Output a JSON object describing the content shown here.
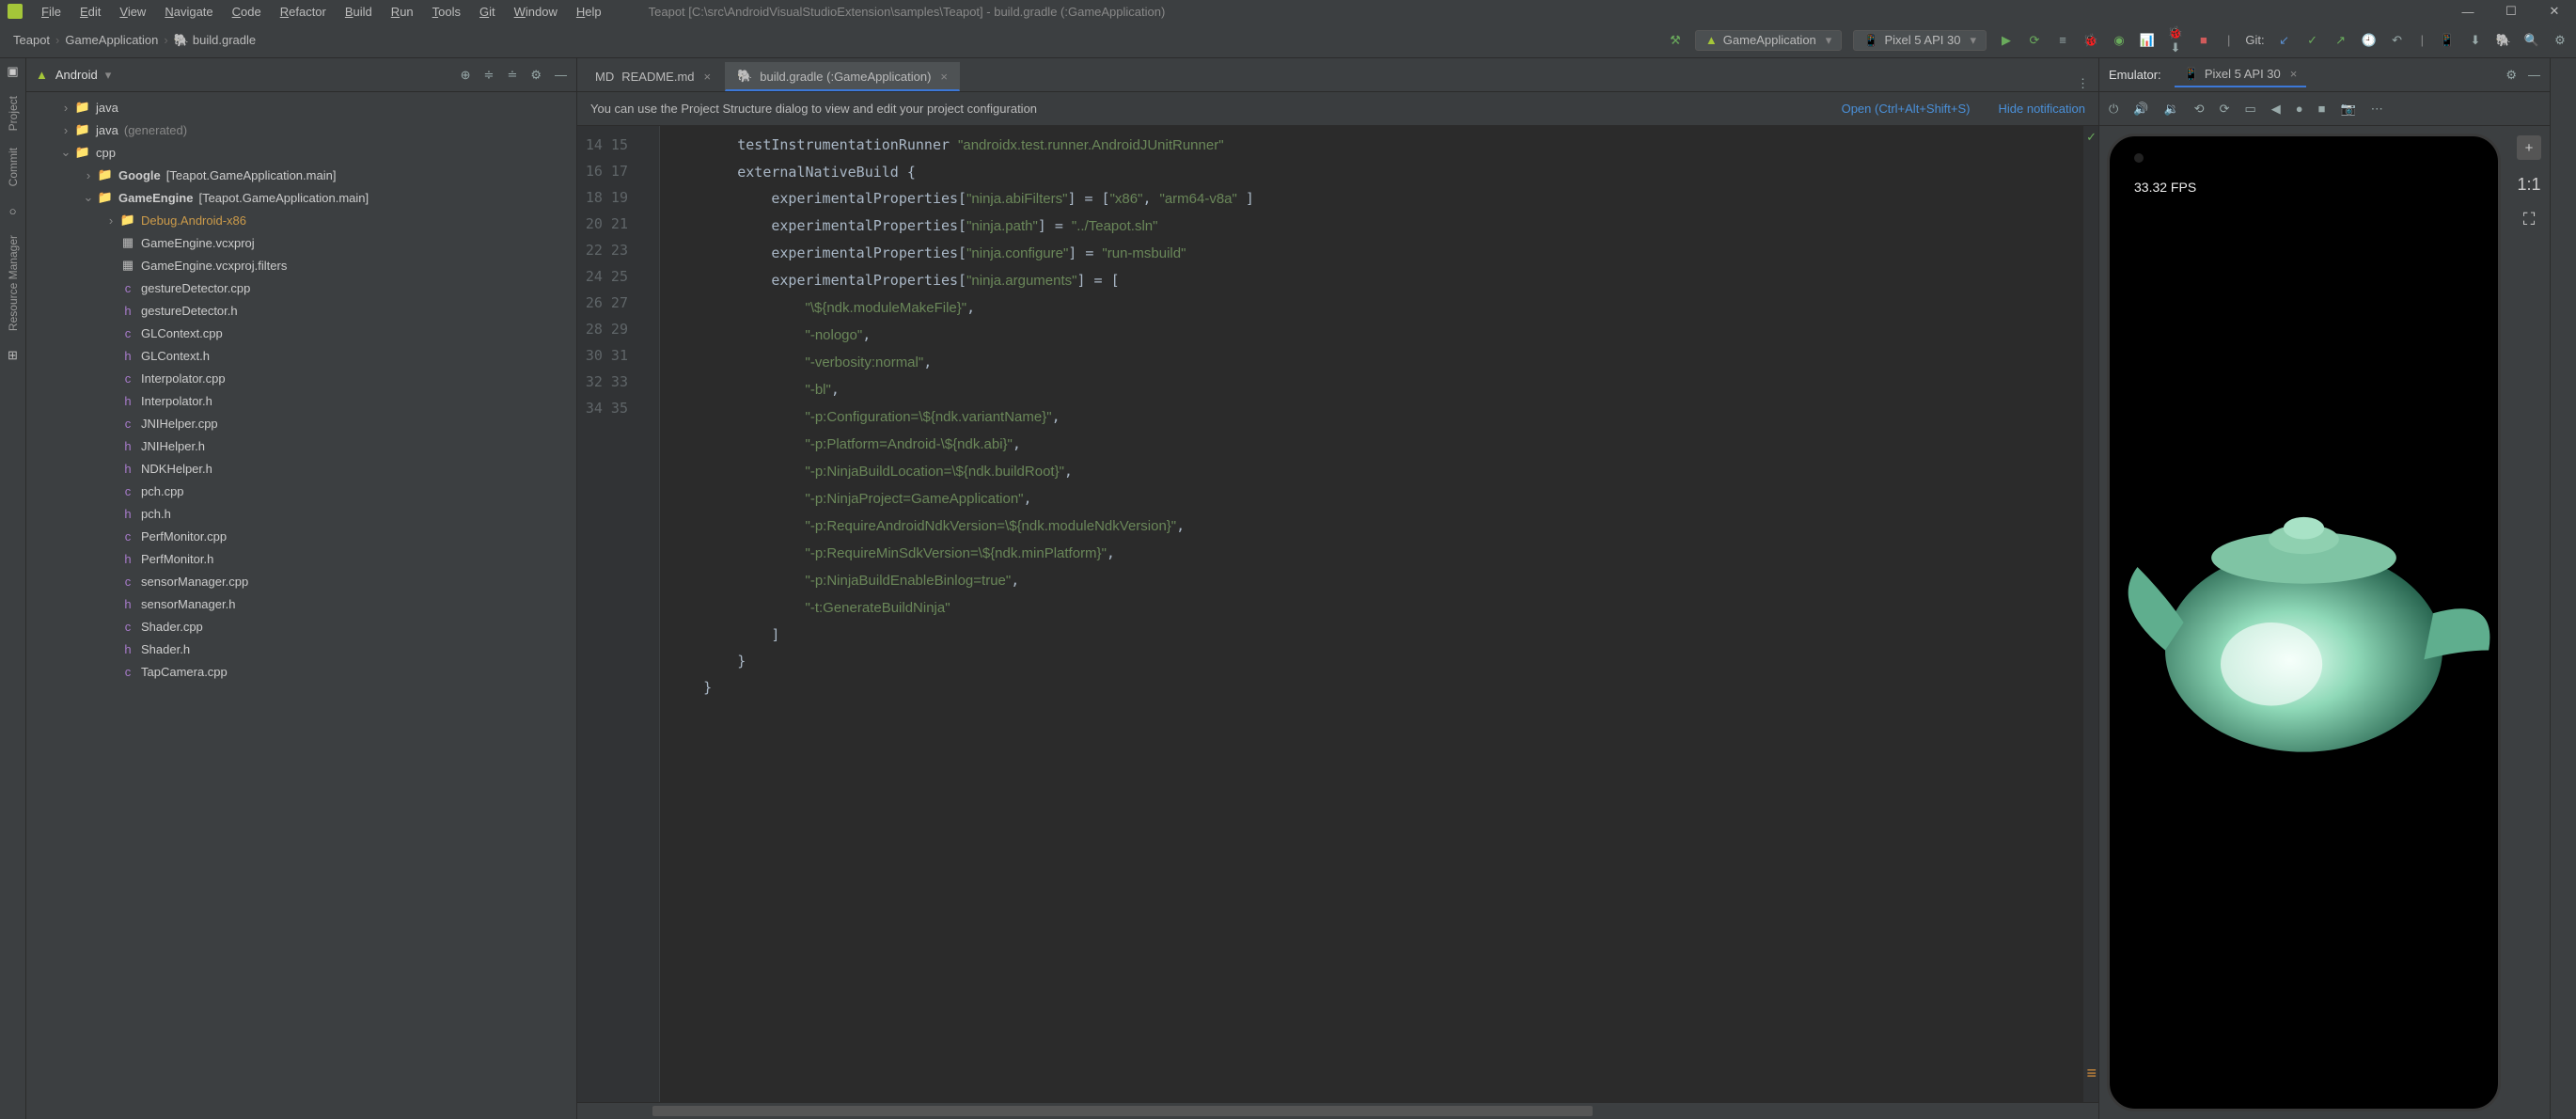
{
  "menu": {
    "items": [
      "File",
      "Edit",
      "View",
      "Navigate",
      "Code",
      "Refactor",
      "Build",
      "Run",
      "Tools",
      "Git",
      "Window",
      "Help"
    ]
  },
  "window_title": "Teapot [C:\\src\\AndroidVisualStudioExtension\\samples\\Teapot] - build.gradle (:GameApplication)",
  "breadcrumbs": {
    "a": "Teapot",
    "b": "GameApplication",
    "c": "build.gradle"
  },
  "run_config": "GameApplication",
  "device": "Pixel 5 API 30",
  "git_label": "Git:",
  "project": {
    "view": "Android",
    "rows": [
      {
        "depth": 1,
        "arrow": "›",
        "ico": "📁",
        "icoClass": "fold-blue",
        "label": "java",
        "dim": false
      },
      {
        "depth": 1,
        "arrow": "›",
        "ico": "📁",
        "icoClass": "fold-teal",
        "label": "java",
        "suffix": "(generated)",
        "dim": true
      },
      {
        "depth": 1,
        "arrow": "⌄",
        "ico": "📁",
        "icoClass": "fold-blue",
        "label": "cpp"
      },
      {
        "depth": 2,
        "arrow": "›",
        "ico": "📁",
        "icoClass": "fold-blue",
        "label": "Google",
        "bold": true,
        "suffix": "[Teapot.GameApplication.main]"
      },
      {
        "depth": 2,
        "arrow": "⌄",
        "ico": "📁",
        "icoClass": "fold-blue",
        "label": "GameEngine",
        "bold": true,
        "suffix": "[Teapot.GameApplication.main]"
      },
      {
        "depth": 3,
        "arrow": "›",
        "ico": "📁",
        "icoClass": "",
        "label": "Debug.Android-x86",
        "gold": true
      },
      {
        "depth": 3,
        "arrow": "",
        "ico": "▦",
        "icoClass": "",
        "label": "GameEngine.vcxproj"
      },
      {
        "depth": 3,
        "arrow": "",
        "ico": "▦",
        "icoClass": "",
        "label": "GameEngine.vcxproj.filters"
      },
      {
        "depth": 3,
        "arrow": "",
        "ico": "c",
        "icoClass": "file-c",
        "label": "gestureDetector.cpp"
      },
      {
        "depth": 3,
        "arrow": "",
        "ico": "h",
        "icoClass": "file-c",
        "label": "gestureDetector.h"
      },
      {
        "depth": 3,
        "arrow": "",
        "ico": "c",
        "icoClass": "file-c",
        "label": "GLContext.cpp"
      },
      {
        "depth": 3,
        "arrow": "",
        "ico": "h",
        "icoClass": "file-c",
        "label": "GLContext.h"
      },
      {
        "depth": 3,
        "arrow": "",
        "ico": "c",
        "icoClass": "file-c",
        "label": "Interpolator.cpp"
      },
      {
        "depth": 3,
        "arrow": "",
        "ico": "h",
        "icoClass": "file-c",
        "label": "Interpolator.h"
      },
      {
        "depth": 3,
        "arrow": "",
        "ico": "c",
        "icoClass": "file-c",
        "label": "JNIHelper.cpp"
      },
      {
        "depth": 3,
        "arrow": "",
        "ico": "h",
        "icoClass": "file-c",
        "label": "JNIHelper.h"
      },
      {
        "depth": 3,
        "arrow": "",
        "ico": "h",
        "icoClass": "file-c",
        "label": "NDKHelper.h"
      },
      {
        "depth": 3,
        "arrow": "",
        "ico": "c",
        "icoClass": "file-c",
        "label": "pch.cpp"
      },
      {
        "depth": 3,
        "arrow": "",
        "ico": "h",
        "icoClass": "file-c",
        "label": "pch.h"
      },
      {
        "depth": 3,
        "arrow": "",
        "ico": "c",
        "icoClass": "file-c",
        "label": "PerfMonitor.cpp"
      },
      {
        "depth": 3,
        "arrow": "",
        "ico": "h",
        "icoClass": "file-c",
        "label": "PerfMonitor.h"
      },
      {
        "depth": 3,
        "arrow": "",
        "ico": "c",
        "icoClass": "file-c",
        "label": "sensorManager.cpp"
      },
      {
        "depth": 3,
        "arrow": "",
        "ico": "h",
        "icoClass": "file-c",
        "label": "sensorManager.h"
      },
      {
        "depth": 3,
        "arrow": "",
        "ico": "c",
        "icoClass": "file-c",
        "label": "Shader.cpp"
      },
      {
        "depth": 3,
        "arrow": "",
        "ico": "h",
        "icoClass": "file-c",
        "label": "Shader.h"
      },
      {
        "depth": 3,
        "arrow": "",
        "ico": "c",
        "icoClass": "file-c",
        "label": "TapCamera.cpp"
      }
    ]
  },
  "tabs": [
    {
      "icon": "MD",
      "label": "README.md",
      "active": false
    },
    {
      "icon": "🐘",
      "label": "build.gradle (:GameApplication)",
      "active": true
    }
  ],
  "banner": {
    "msg": "You can use the Project Structure dialog to view and edit your project configuration",
    "open": "Open (Ctrl+Alt+Shift+S)",
    "hide": "Hide notification"
  },
  "lines": {
    "start": 14,
    "end": 35
  },
  "code": "        testInstrumentationRunner <s>\"androidx.test.runner.AndroidJUnitRunner\"</s>\n        externalNativeBuild {\n            experimentalProperties[<s>\"ninja.abiFilters\"</s>] = [<s>\"x86\"</s>, <s>\"arm64-v8a\"</s> ]\n            experimentalProperties[<s>\"ninja.path\"</s>] = <s>\"../Teapot.sln\"</s>\n            experimentalProperties[<s>\"ninja.configure\"</s>] = <s>\"run-msbuild\"</s>\n            experimentalProperties[<s>\"ninja.arguments\"</s>] = [\n                <s>\"\\${ndk.moduleMakeFile}\"</s>,\n                <s>\"-nologo\"</s>,\n                <s>\"-verbosity:normal\"</s>,\n                <s>\"-bl\"</s>,\n                <s>\"-p:Configuration=\\${ndk.variantName}\"</s>,\n                <s>\"-p:Platform=Android-\\${ndk.abi}\"</s>,\n                <s>\"-p:NinjaBuildLocation=\\${ndk.buildRoot}\"</s>,\n                <s>\"-p:NinjaProject=GameApplication\"</s>,\n                <s>\"-p:RequireAndroidNdkVersion=\\${ndk.moduleNdkVersion}\"</s>,\n                <s>\"-p:RequireMinSdkVersion=\\${ndk.minPlatform}\"</s>,\n                <s>\"-p:NinjaBuildEnableBinlog=true\"</s>,\n                <s>\"-t:GenerateBuildNinja\"</s>\n            ]\n        }\n    }",
  "emulator": {
    "title": "Emulator:",
    "tab": "Pixel 5 API 30",
    "fps": "33.32 FPS",
    "btns": {
      "zoom": "+",
      "fit": "1:1",
      "full": "⛶"
    }
  },
  "sidetools": {
    "project": "Project",
    "commit": "Commit",
    "res": "Resource Manager"
  }
}
